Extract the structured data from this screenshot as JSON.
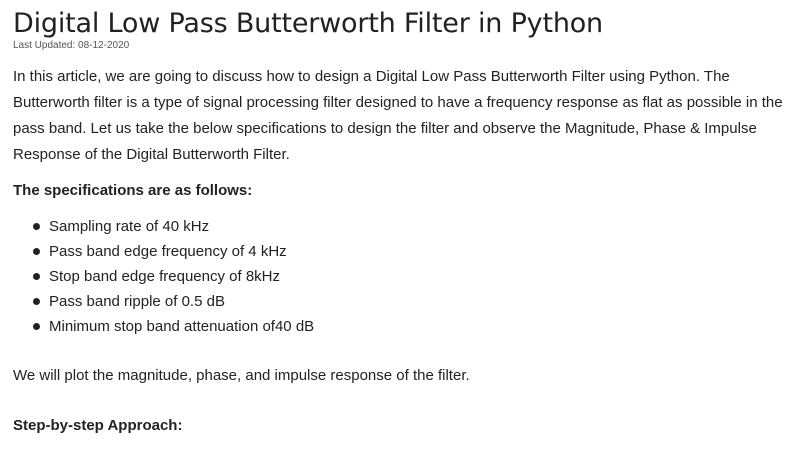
{
  "article": {
    "title": "Digital Low Pass Butterworth Filter in Python",
    "last_updated": "Last Updated: 08-12-2020",
    "intro": "In this article, we are going to discuss how to design a Digital Low Pass Butterworth Filter using Python. The Butterworth filter is a type of signal processing filter designed to have a frequency response as flat as possible in the pass band. Let us take the below specifications to design the filter and observe the Magnitude, Phase & Impulse Response of the Digital Butterworth Filter.",
    "specs_heading": "The specifications are as follows:",
    "specs": [
      "Sampling rate of 40 kHz",
      "Pass band edge frequency of 4 kHz",
      "Stop band edge frequency of 8kHz",
      "Pass band ripple of 0.5 dB",
      "Minimum stop band attenuation of40 dB"
    ],
    "plot_text": "We will plot the magnitude, phase, and impulse response of the filter.",
    "step_heading": "Step-by-step Approach:"
  }
}
